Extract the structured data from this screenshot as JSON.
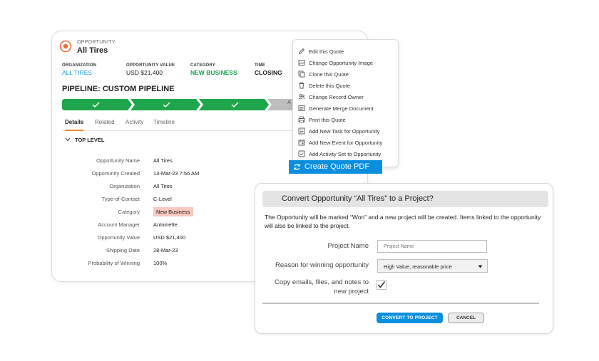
{
  "opportunity": {
    "type_label": "OPPORTUNITY",
    "name": "All Tires",
    "meta": [
      {
        "key": "ORGANIZATION",
        "value": "ALL TIRES"
      },
      {
        "key": "OPPORTUNITY VALUE",
        "value": "USD $21,400"
      },
      {
        "key": "CATEGORY",
        "value": "NEW BUSINESS"
      },
      {
        "key": "TIME",
        "value": "CLOSING"
      }
    ]
  },
  "pipeline": {
    "title": "PIPELINE: CUSTOM PIPELINE",
    "stage_truncated_label": "A",
    "colors": {
      "complete": "#1fa64d",
      "pending": "#bdbdbd"
    }
  },
  "tabs": [
    "Details",
    "Related",
    "Activity",
    "Timeline"
  ],
  "section": {
    "title": "TOP LEVEL"
  },
  "fields": [
    {
      "label": "Opportunity Name",
      "value": "All Tires"
    },
    {
      "label": "Opportunity Created",
      "value": "13-Mar-23 7:56 AM"
    },
    {
      "label": "Organization",
      "value": "All Tires"
    },
    {
      "label": "Type-of-Contact",
      "value": "C-Level"
    },
    {
      "label": "Category",
      "value": "New Business"
    },
    {
      "label": "Account Manager",
      "value": "Antoinette"
    },
    {
      "label": "Opportunity Value",
      "value": "USD $21,400"
    },
    {
      "label": "Shipping Date",
      "value": "28-Mar-23"
    },
    {
      "label": "Probability of Winning",
      "value": "100%"
    }
  ],
  "menu": {
    "items": [
      {
        "label": "Edit this Quote",
        "icon": "pencil-icon"
      },
      {
        "label": "Change Opportunity Image",
        "icon": "image-icon"
      },
      {
        "label": "Clone this Quote",
        "icon": "copy-icon"
      },
      {
        "label": "Delete this Quote",
        "icon": "trash-icon"
      },
      {
        "label": "Change Record Owner",
        "icon": "users-icon"
      },
      {
        "label": "Generate Merge Document",
        "icon": "document-icon"
      },
      {
        "label": "Print this Quote",
        "icon": "printer-icon"
      },
      {
        "label": "Add New Task for Opportunity",
        "icon": "task-icon"
      },
      {
        "label": "Add New Event for Opportunity",
        "icon": "calendar-icon"
      },
      {
        "label": "Add Activity Set to Opportunity",
        "icon": "checkbox-icon"
      }
    ],
    "highlight": {
      "label": "Create Quote PDF",
      "icon": "refresh-icon"
    }
  },
  "dialog": {
    "title": "Convert Opportunity “All Tires” to a Project?",
    "body": "The Opportunity will be  marked “Won” and a new project will be created. Items linked to the opportunity will also be linked to the project.",
    "project_name_label": "Project Name",
    "project_name_placeholder": "Project Name",
    "reason_label": "Reason for winning opportunity",
    "reason_value": "High Value, reasonable price",
    "copy_label": "Copy emails, files, and notes to new project",
    "copy_checked": true,
    "convert_label": "CONVERT TO PROJECT",
    "cancel_label": "CANCEL"
  },
  "colors": {
    "accent": "#0a8fde",
    "link": "#1e9ad6",
    "success": "#1aa251",
    "tab_indicator": "#f08a24",
    "badge_bg": "#f7c9bf"
  }
}
